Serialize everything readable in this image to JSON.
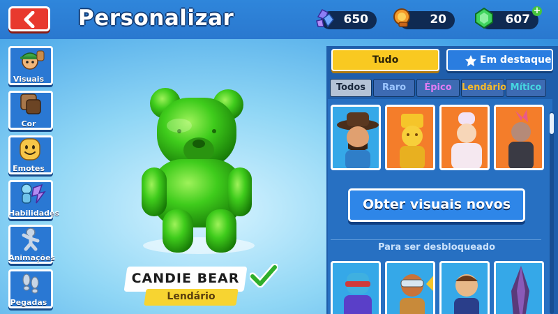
{
  "header": {
    "title": "Personalizar",
    "currencies": [
      {
        "icon": "gem-cluster-icon",
        "value": "650"
      },
      {
        "icon": "trophy-token-icon",
        "value": "20"
      },
      {
        "icon": "emerald-icon",
        "value": "607"
      }
    ]
  },
  "nav": {
    "items": [
      {
        "label": "Visuais",
        "icon": "character-head-icon"
      },
      {
        "label": "Cor",
        "icon": "color-swatch-icon"
      },
      {
        "label": "Emotes",
        "icon": "smiley-icon"
      },
      {
        "label": "Habilidades",
        "icon": "ability-icon"
      },
      {
        "label": "Animações",
        "icon": "figure-pose-icon"
      },
      {
        "label": "Pegadas",
        "icon": "footprints-icon"
      }
    ]
  },
  "character": {
    "name": "CANDIE BEAR",
    "rarity": "Lendário"
  },
  "panel": {
    "tab_all": "Tudo",
    "tab_featured": "Em destaque",
    "filters": [
      {
        "label": "Todos",
        "bg": "#b4c3d6",
        "fg": "#1c2a3e"
      },
      {
        "label": "Raro",
        "bg": "#3d6bb3",
        "fg": "#9cc6ff"
      },
      {
        "label": "Épico",
        "bg": "#3d6bb3",
        "fg": "#e07cf2"
      },
      {
        "label": "Lendário",
        "bg": "#3d6bb3",
        "fg": "#f5b92a"
      },
      {
        "label": "Mítico",
        "bg": "#3d6bb3",
        "fg": "#45d6e0"
      }
    ],
    "get_button": "Obter visuais novos",
    "section_title": "Para ser desbloqueado"
  },
  "colors": {
    "accent": "#f9c921",
    "legendary_bg": "#f47d2a",
    "rare_bg": "#35a8e8",
    "character_green": "#38c81c"
  }
}
